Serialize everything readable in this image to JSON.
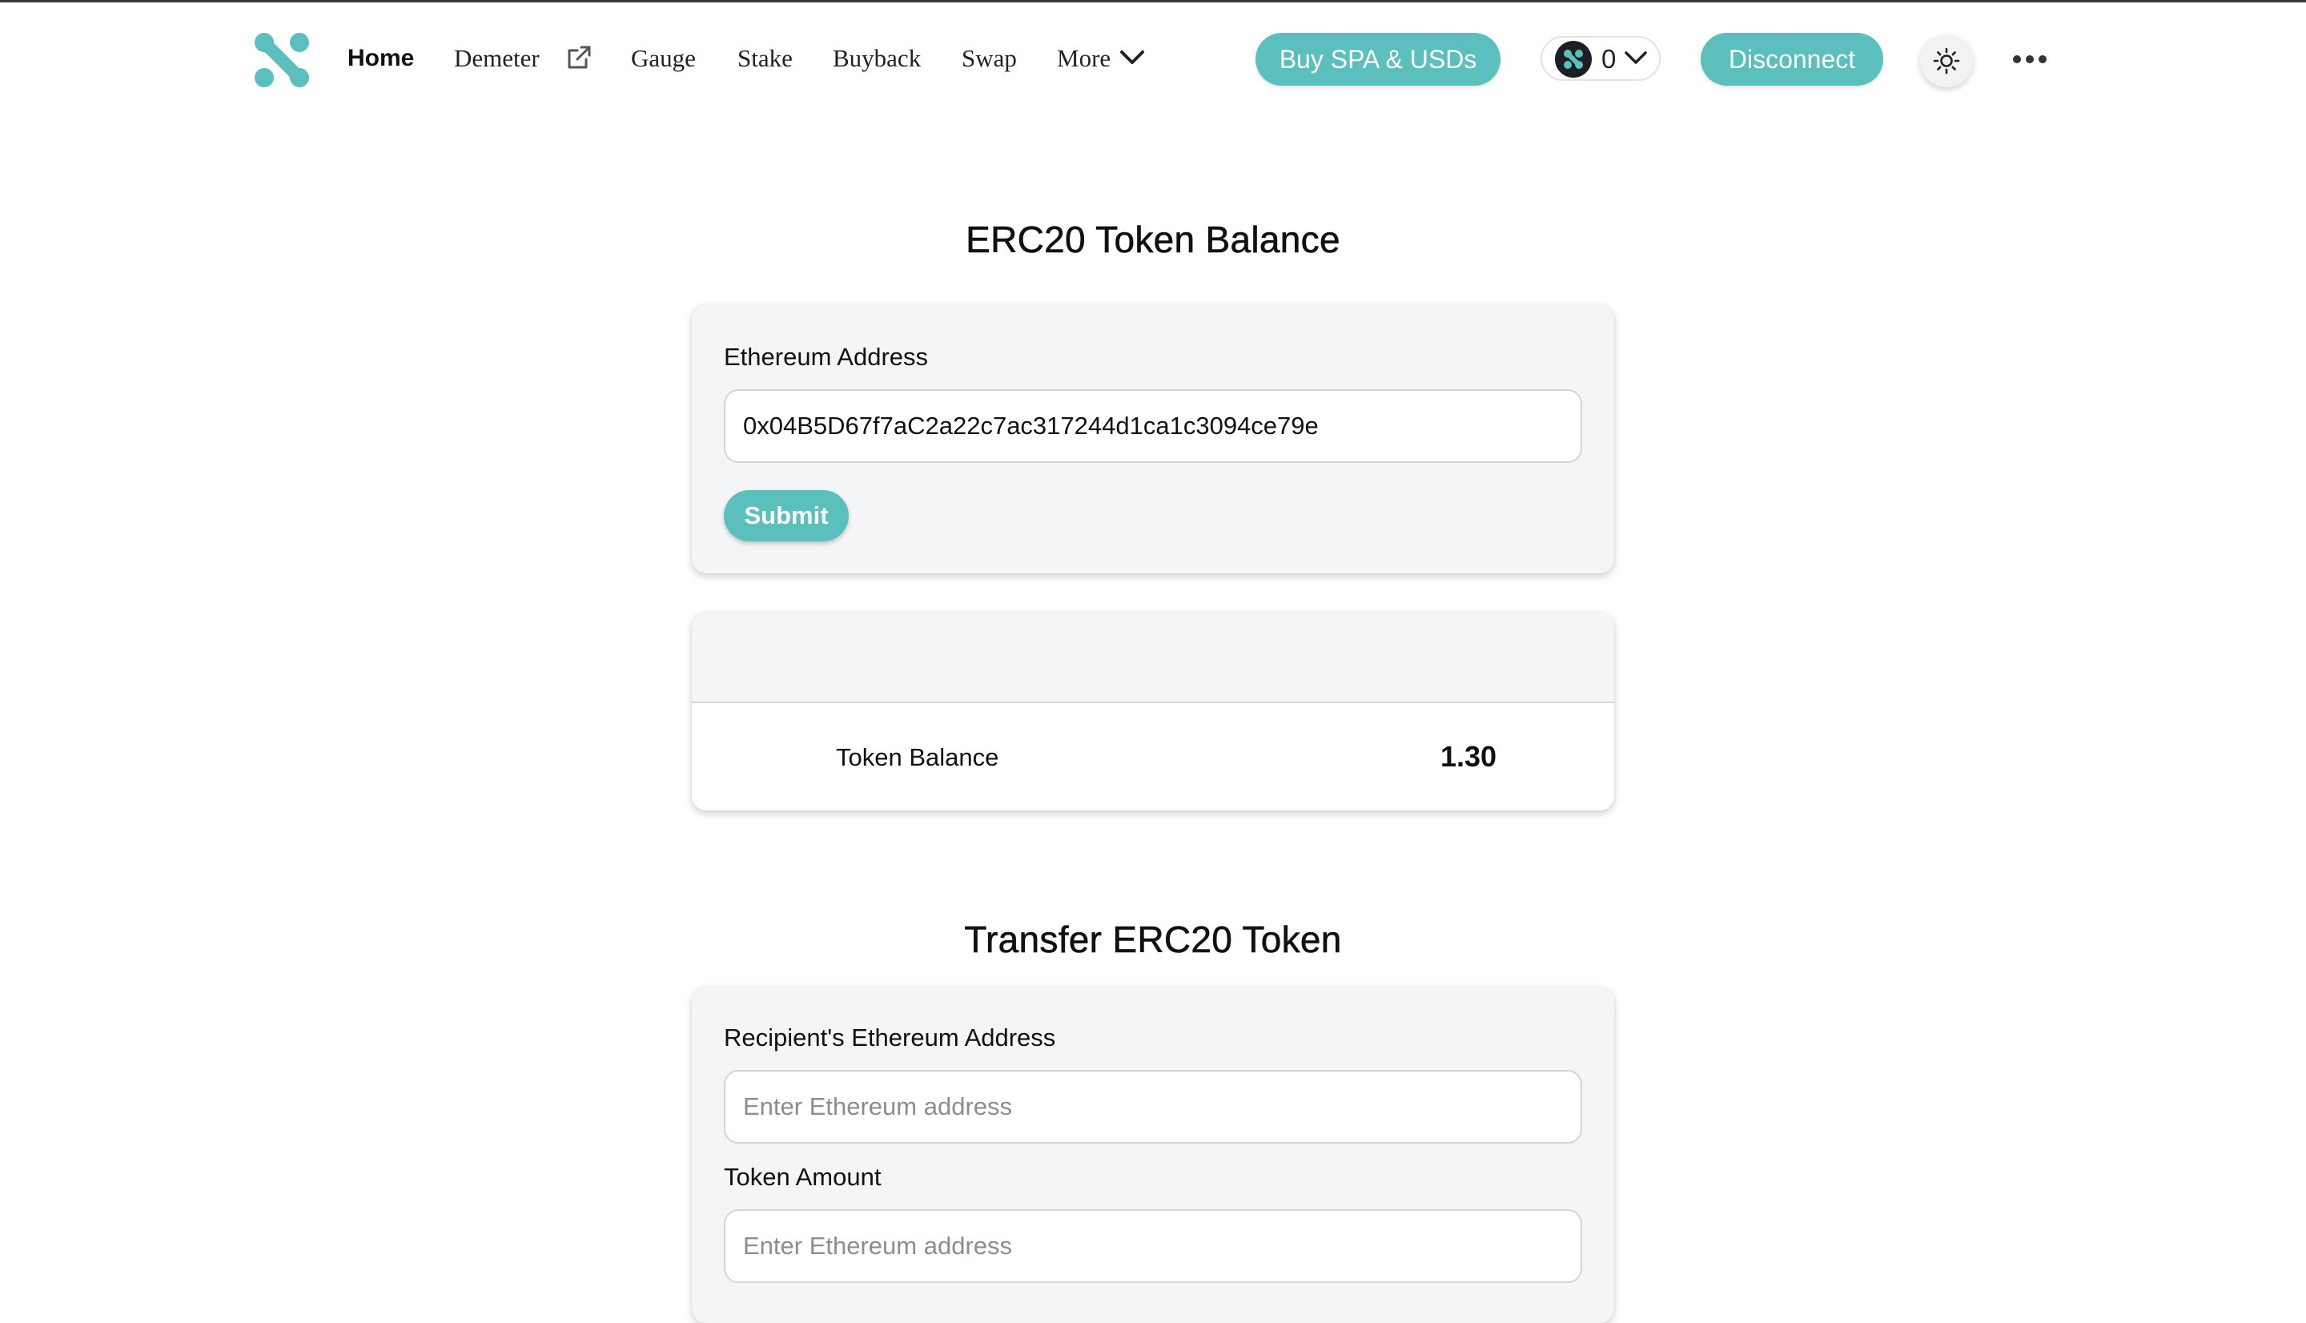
{
  "nav": {
    "links": {
      "home": "Home",
      "demeter": "Demeter",
      "gauge": "Gauge",
      "stake": "Stake",
      "buyback": "Buyback",
      "swap": "Swap",
      "more": "More"
    },
    "buy_button": "Buy SPA & USDs",
    "wallet_count": "0",
    "disconnect_button": "Disconnect",
    "icons": {
      "logo": "sperax-logo",
      "external": "external-link-icon",
      "more": "chevron-down-icon",
      "wallet": "wallet-avatar-icon",
      "theme": "sun-icon",
      "overflow": "ellipsis-icon"
    }
  },
  "balance_section": {
    "title": "ERC20 Token Balance",
    "address_label": "Ethereum Address",
    "address_value": "0x04B5D67f7aC2a22c7ac317244d1ca1c3094ce79e",
    "submit_label": "Submit",
    "token_balance_label": "Token Balance",
    "token_balance_value": "1.30"
  },
  "transfer_section": {
    "title": "Transfer ERC20 Token",
    "recipient_label": "Recipient's Ethereum Address",
    "recipient_placeholder": "Enter Ethereum address",
    "amount_label": "Token Amount",
    "amount_placeholder": "Enter Ethereum address"
  },
  "colors": {
    "accent": "#5bbfbd",
    "card_bg": "#f4f5f6",
    "text": "#111111"
  }
}
